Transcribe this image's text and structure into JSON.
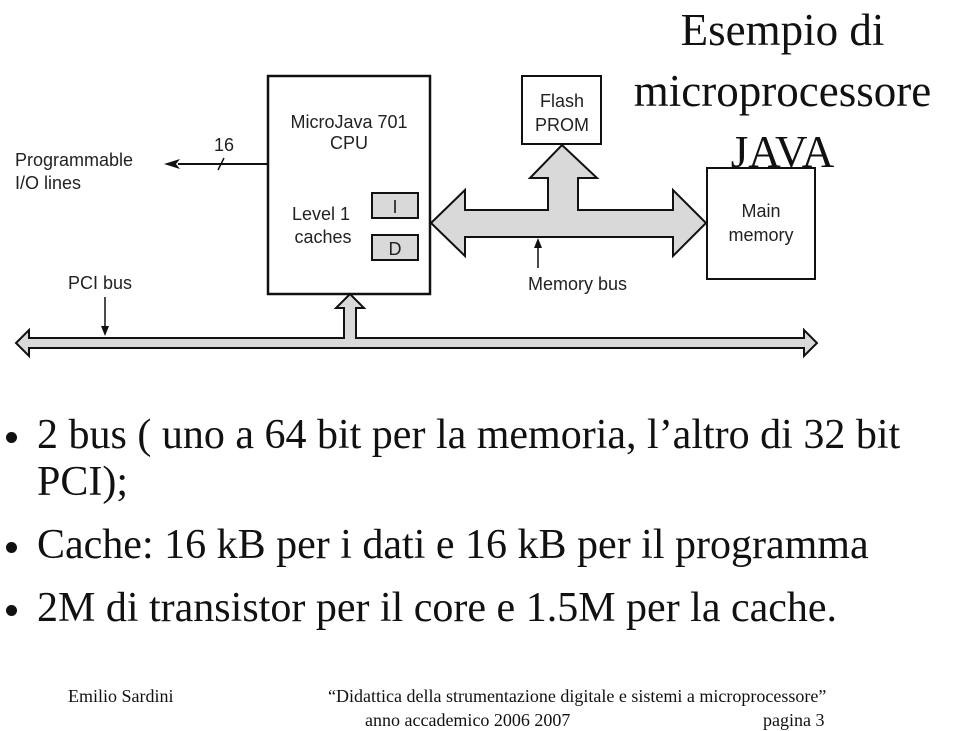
{
  "slide": {
    "title_lines": [
      "Esempio di",
      "microprocessore",
      "JAVA"
    ],
    "diagram": {
      "io_label_line1": "Programmable",
      "io_label_line2": "I/O lines",
      "io_width": "16",
      "cpu_line1": "MicroJava 701",
      "cpu_line2": "CPU",
      "cache_line1": "Level 1",
      "cache_line2": "caches",
      "cache_i": "I",
      "cache_d": "D",
      "flash_line1": "Flash",
      "flash_line2": "PROM",
      "mem_line1": "Main",
      "mem_line2": "memory",
      "memory_bus_label": "Memory bus",
      "pci_bus_label": "PCI bus",
      "colors": {
        "bus_fill": "#d9d9d9",
        "stroke": "#111111"
      }
    },
    "bullets": [
      "2 bus ( uno a 64 bit per la memoria, l’altro di 32 bit PCI);",
      "Cache: 16 kB per i dati e 16 kB per il programma",
      "2M di transistor per il core e 1.5M per la cache."
    ],
    "footer": {
      "author": "Emilio Sardini",
      "course": "“Didattica della strumentazione digitale e sistemi a microprocessore”",
      "year": "anno accademico 2006 2007",
      "page": "pagina 3"
    }
  }
}
